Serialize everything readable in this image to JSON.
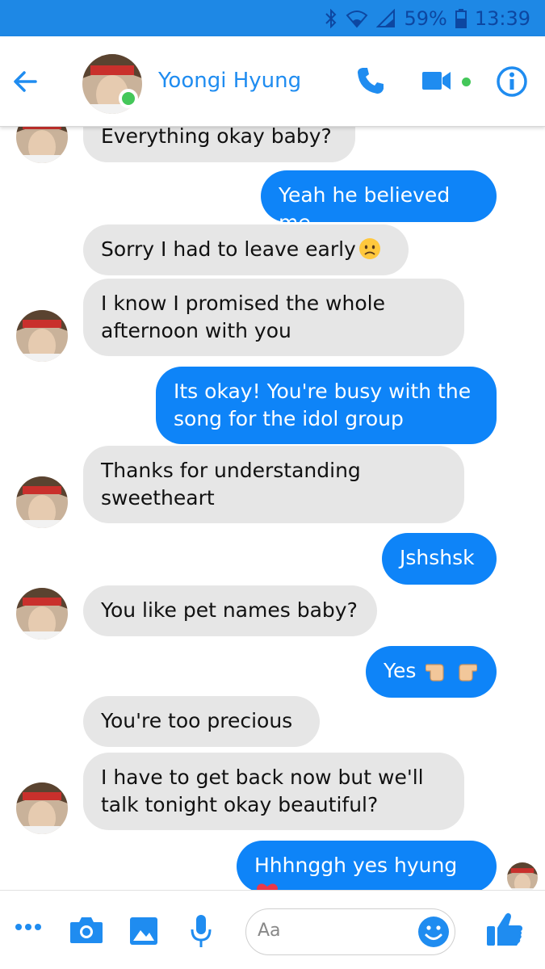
{
  "status_bar": {
    "battery": "59%",
    "time": "13:39"
  },
  "header": {
    "contact_name": "Yoongi Hyung"
  },
  "messages": [
    {
      "side": "received",
      "text": "Everything okay baby?"
    },
    {
      "side": "sent",
      "text": "Yeah he believed me"
    },
    {
      "side": "received",
      "text": "Sorry I had to leave early"
    },
    {
      "side": "received",
      "text": "I know I promised the whole afternoon with you"
    },
    {
      "side": "sent",
      "text": "Its okay! You're busy with the song for the idol group"
    },
    {
      "side": "received",
      "text": "Thanks for understanding sweetheart"
    },
    {
      "side": "sent",
      "text": "Jshshsk"
    },
    {
      "side": "received",
      "text": "You like pet names baby?"
    },
    {
      "side": "sent",
      "text": "Yes"
    },
    {
      "side": "received",
      "text": "You're too precious"
    },
    {
      "side": "received",
      "text": "I have to get back now but we'll talk tonight okay beautiful?"
    },
    {
      "side": "sent",
      "text": "Hhhnggh yes hyung"
    }
  ],
  "composer": {
    "placeholder": "Aa"
  },
  "colors": {
    "accent": "#0e84f8",
    "status_bar": "#1e88e5",
    "received_bubble": "#e6e6e6",
    "online": "#44c759"
  },
  "icons": [
    "back-arrow-icon",
    "phone-icon",
    "video-camera-icon",
    "info-icon",
    "more-icon",
    "camera-icon",
    "gallery-icon",
    "microphone-icon",
    "emoji-icon",
    "thumbs-up-icon"
  ]
}
